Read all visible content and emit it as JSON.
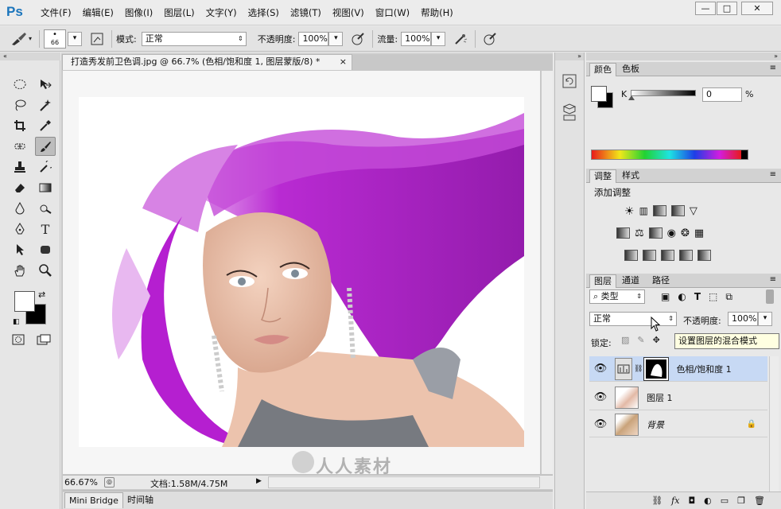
{
  "app": {
    "logo": "Ps"
  },
  "menu": [
    "文件(F)",
    "编辑(E)",
    "图像(I)",
    "图层(L)",
    "文字(Y)",
    "选择(S)",
    "滤镜(T)",
    "视图(V)",
    "窗口(W)",
    "帮助(H)"
  ],
  "window_buttons": {
    "minimize": "—",
    "maximize": "□",
    "close": "✕"
  },
  "options": {
    "brush_size": "66",
    "mode_label": "模式:",
    "mode_value": "正常",
    "opacity_label": "不透明度:",
    "opacity_value": "100%",
    "flow_label": "流量:",
    "flow_value": "100%"
  },
  "document": {
    "tab_title": "打造秀发前卫色调.jpg @ 66.7% (色相/饱和度 1, 图层蒙版/8) *",
    "tab_close": "×",
    "zoom": "66.67%",
    "doc_info": "文档:1.58M/4.75M"
  },
  "bottom_tabs": [
    "Mini Bridge",
    "时间轴"
  ],
  "color_panel": {
    "tabs": [
      "颜色",
      "色板"
    ],
    "channel_label": "K",
    "value": "0",
    "unit": "%",
    "brightness_percent": 0
  },
  "adjust_panel": {
    "tabs": [
      "调整",
      "样式"
    ],
    "title": "添加调整"
  },
  "layers_panel": {
    "tabs": [
      "图层",
      "通道",
      "路径"
    ],
    "filter_label": "类型",
    "blend_mode": "正常",
    "opacity_label": "不透明度:",
    "opacity_value": "100%",
    "lock_label": "锁定:",
    "tooltip": "设置图层的混合模式",
    "layers": [
      {
        "name": "色相/饱和度 1",
        "selected": true
      },
      {
        "name": "图层 1",
        "selected": false
      },
      {
        "name": "背景",
        "selected": false
      }
    ]
  },
  "watermark": "人人素材",
  "colors": {
    "hair": "#b51fd0",
    "selected_layer": "#c7d9f4",
    "ps_blue": "#1b75bc"
  }
}
